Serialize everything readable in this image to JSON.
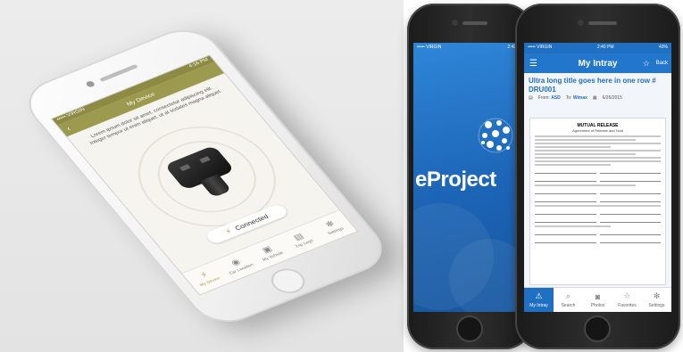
{
  "left_app": {
    "status_bar": {
      "carrier": "••••• VIRGIN",
      "time": "4:16 PM"
    },
    "nav_title": "My Device",
    "back_glyph": "‹",
    "info_text": "Lorem ipsum dolor sit amet, consectetur adipiscing elit. Integer tempor ut enim aliquet, ut at sodales magna aliquet.",
    "connected_label": "Connected",
    "accent_color": "#9b9a4e",
    "tabs": [
      {
        "label": "My Device",
        "icon": "charger-icon",
        "glyph": "⚡",
        "active": true
      },
      {
        "label": "Car Location",
        "icon": "location-icon",
        "glyph": "◉",
        "active": false
      },
      {
        "label": "My Vehicle",
        "icon": "car-icon",
        "glyph": "▣",
        "active": false
      },
      {
        "label": "Trip Logs",
        "icon": "log-icon",
        "glyph": "▤",
        "active": false
      },
      {
        "label": "Settings",
        "icon": "gear-icon",
        "glyph": "✻",
        "active": false
      }
    ]
  },
  "splash_app": {
    "status_bar": {
      "carrier": "••••• VIRGIN",
      "time": "2:40 PM"
    },
    "brand": "eProject",
    "bg_color": "#1f6fc2"
  },
  "intray_app": {
    "status_bar": {
      "carrier": "••••• VIRGIN",
      "time": "2:40 PM",
      "battery": "43%"
    },
    "nav": {
      "title": "My Intray",
      "back": "Back"
    },
    "headline": "Ultra long title goes here in one row # DRU001",
    "meta": {
      "from_label": "From:",
      "from_value": "ASD",
      "to_label": "To:",
      "to_value": "Wimax",
      "date": "6/26/2015"
    },
    "document": {
      "title": "MUTUAL RELEASE",
      "subtitle": "Agreement of Release and Hold"
    },
    "tabs": [
      {
        "label": "My Intray",
        "icon": "intray-icon",
        "glyph": "⚠",
        "active": true
      },
      {
        "label": "Search",
        "icon": "search-icon",
        "glyph": "⌕",
        "active": false
      },
      {
        "label": "Photos",
        "icon": "camera-icon",
        "glyph": "◙",
        "active": false
      },
      {
        "label": "Favorites",
        "icon": "star-icon",
        "glyph": "☆",
        "active": false
      },
      {
        "label": "Settings",
        "icon": "gear-icon",
        "glyph": "✻",
        "active": false
      }
    ]
  }
}
